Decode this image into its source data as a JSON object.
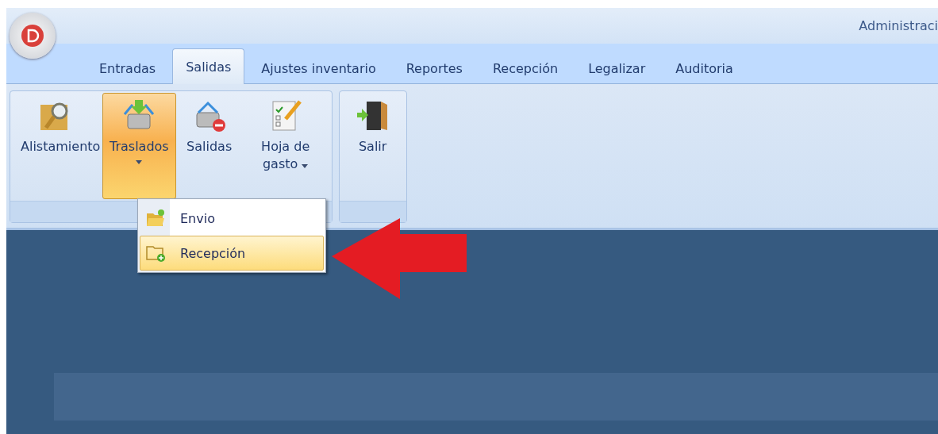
{
  "window": {
    "title": "Administraci"
  },
  "tabs": [
    {
      "label": "Entradas",
      "selected": false
    },
    {
      "label": "Salidas",
      "selected": true
    },
    {
      "label": "Ajustes inventario",
      "selected": false
    },
    {
      "label": "Reportes",
      "selected": false
    },
    {
      "label": "Recepción",
      "selected": false
    },
    {
      "label": "Legalizar",
      "selected": false
    },
    {
      "label": "Auditoria",
      "selected": false
    }
  ],
  "ribbon_groups": [
    {
      "buttons": [
        {
          "label": "Alistamiento",
          "kind": "search-box",
          "pressed": false,
          "has_menu": false
        },
        {
          "label": "Traslados",
          "kind": "basket-in",
          "pressed": true,
          "has_menu": true
        },
        {
          "label": "Salidas",
          "kind": "basket-remove",
          "pressed": false,
          "has_menu": false
        },
        {
          "label": "Hoja de gasto",
          "kind": "checklist",
          "pressed": false,
          "has_menu": true
        }
      ]
    },
    {
      "buttons": [
        {
          "label": "Salir",
          "kind": "door",
          "pressed": false,
          "has_menu": false
        }
      ]
    }
  ],
  "menu": {
    "items": [
      {
        "label": "Envio",
        "kind": "folder-open",
        "selected": false
      },
      {
        "label": "Recepción",
        "kind": "folder-add",
        "selected": true
      }
    ]
  }
}
